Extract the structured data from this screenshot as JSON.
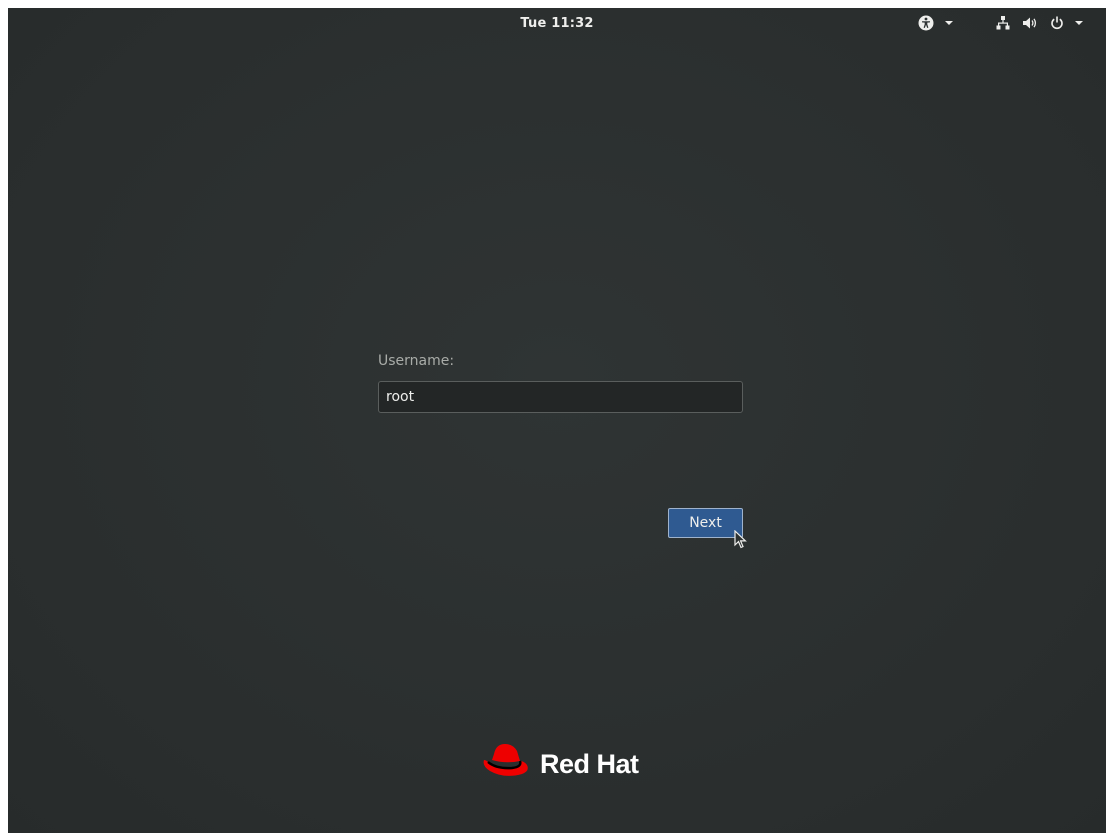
{
  "topbar": {
    "clock": "Tue 11:32",
    "icons": {
      "accessibility": "accessibility-icon",
      "network": "network-wired-icon",
      "volume": "volume-icon",
      "power": "power-icon"
    }
  },
  "login": {
    "username_label": "Username:",
    "username_value": "root",
    "next_label": "Next"
  },
  "brand": {
    "name": "Red Hat",
    "logo_color": "#ee0000"
  },
  "colors": {
    "background": "#2c3131",
    "button": "#2f5a91",
    "text": "#eeeeec"
  }
}
